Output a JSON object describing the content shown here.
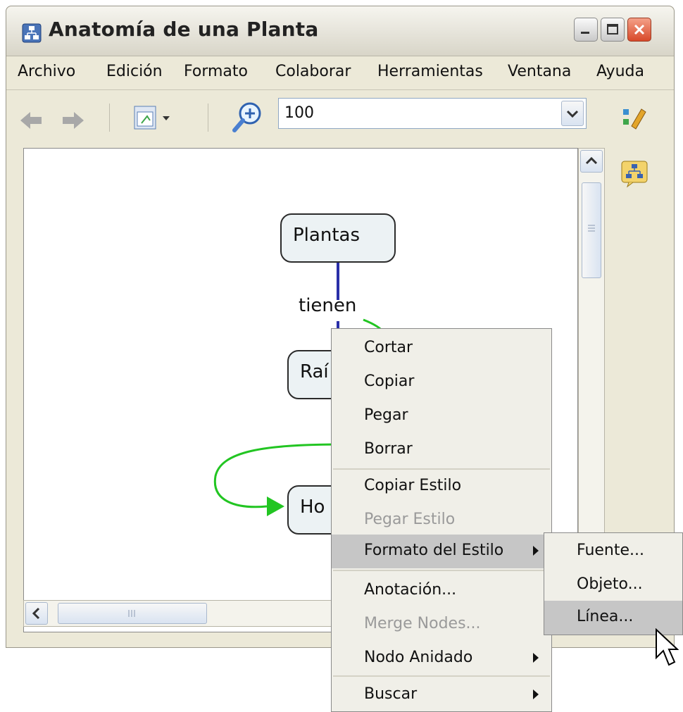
{
  "window": {
    "title": "Anatomía de una Planta"
  },
  "menubar": {
    "items": [
      "Archivo",
      "Edición",
      "Formato",
      "Colaborar",
      "Herramientas",
      "Ventana",
      "Ayuda"
    ]
  },
  "toolbar": {
    "zoom_value": "100"
  },
  "map": {
    "nodes": [
      {
        "label": "Plantas"
      },
      {
        "label": "Raí"
      },
      {
        "label": "Ho"
      }
    ],
    "link_label": "tienen"
  },
  "context_menu": {
    "items": [
      {
        "label": "Cortar",
        "enabled": true
      },
      {
        "label": "Copiar",
        "enabled": true
      },
      {
        "label": "Pegar",
        "enabled": true
      },
      {
        "label": "Borrar",
        "enabled": true
      },
      {
        "label": "Copiar Estilo",
        "enabled": true
      },
      {
        "label": "Pegar Estilo",
        "enabled": false
      },
      {
        "label": "Formato del Estilo",
        "enabled": true,
        "submenu": true,
        "highlighted": true
      },
      {
        "label": "Anotación...",
        "enabled": true
      },
      {
        "label": "Merge Nodes...",
        "enabled": false
      },
      {
        "label": "Nodo Anidado",
        "enabled": true,
        "submenu": true
      },
      {
        "label": "Buscar",
        "enabled": true,
        "submenu": true
      }
    ]
  },
  "submenu": {
    "items": [
      {
        "label": "Fuente..."
      },
      {
        "label": "Objeto..."
      },
      {
        "label": "Línea...",
        "highlighted": true
      }
    ]
  },
  "colors": {
    "link_blue": "#2a2fa8",
    "link_green": "#22c522",
    "highlight": "#c6c6c6"
  },
  "icons": [
    "app-icon",
    "back-arrow-icon",
    "forward-arrow-icon",
    "view-menu-icon",
    "zoom-icon",
    "dropdown-arrow-icon",
    "style-icon",
    "concept-map-icon",
    "cursor-icon"
  ]
}
